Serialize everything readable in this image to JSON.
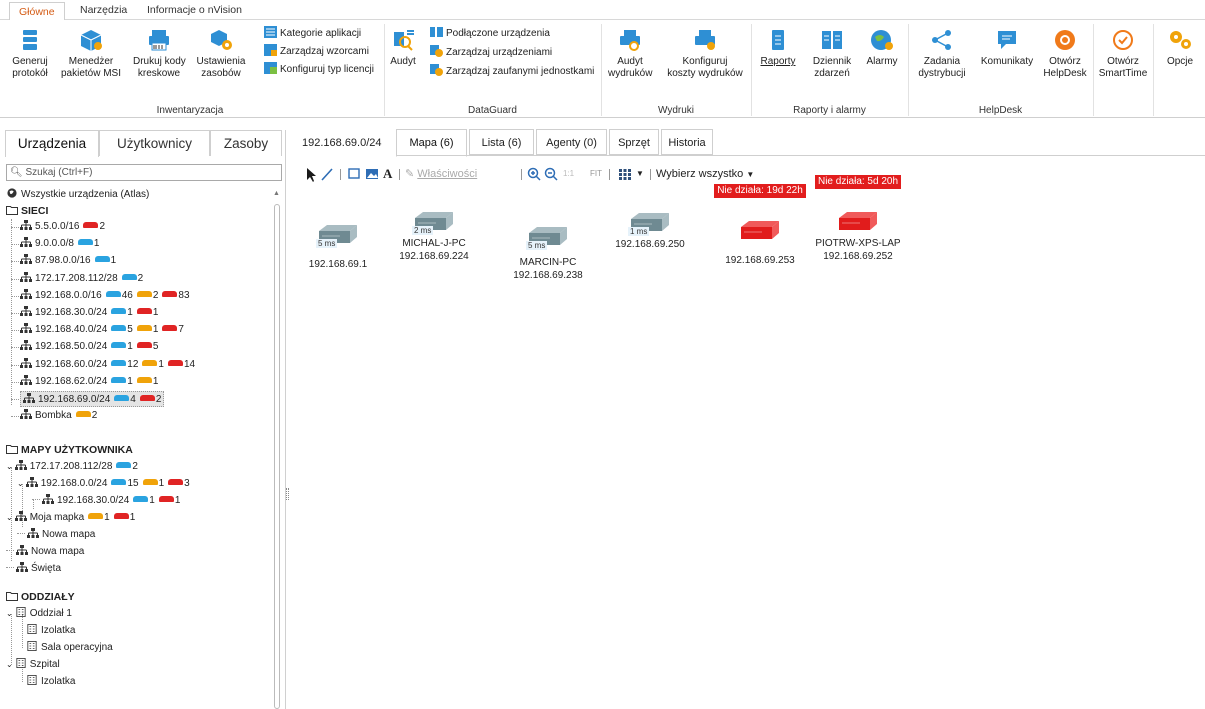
{
  "ribbon": {
    "tabs": [
      "Główne",
      "Narzędzia",
      "Informacje o nVision"
    ],
    "buttons": {
      "generuj": "Generuj\nprotokół",
      "menedzer": "Menedżer\npakietów MSI",
      "drukuj": "Drukuj kody\nkreskowe",
      "ustawienia": "Ustawienia\nzasobów",
      "kategorie": "Kategorie aplikacji",
      "wzorce": "Zarządzaj wzorcami",
      "licencje": "Konfiguruj typ licencji",
      "audyt": "Audyt",
      "podlaczone": "Podłączone urządzenia",
      "zarzadzaj_urz": "Zarządzaj urządzeniami",
      "zaufane": "Zarządzaj zaufanymi jednostkami",
      "audyt_wydrukow": "Audyt\nwydruków",
      "koszty": "Konfiguruj\nkoszty wydruków",
      "raporty": "Raporty",
      "dziennik": "Dziennik\nzdarzeń",
      "alarmy": "Alarmy",
      "zadania": "Zadania\ndystrybucji",
      "komunikaty": "Komunikaty",
      "helpdesk": "Otwórz\nHelpDesk",
      "smarttime": "Otwórz\nSmartTime",
      "opcje": "Opcje"
    },
    "groups": {
      "inwentaryzacja": "Inwentaryzacja",
      "dataguard": "DataGuard",
      "wydruki": "Wydruki",
      "raporty": "Raporty i alarmy",
      "helpdesk": "HelpDesk"
    }
  },
  "left": {
    "tabs": [
      "Urządzenia",
      "Użytkownicy",
      "Zasoby"
    ],
    "search_placeholder": "Szukaj (Ctrl+F)",
    "all_devices": "Wszystkie urządzenia (Atlas)",
    "sections": {
      "sieci": "SIECI",
      "mapy": "MAPY UŻYTKOWNIKA",
      "oddzialy": "ODDZIAŁY"
    },
    "networks": [
      {
        "name": "5.5.0.0/16",
        "counts": [
          {
            "c": "r",
            "n": "2"
          }
        ]
      },
      {
        "name": "9.0.0.0/8",
        "counts": [
          {
            "c": "b",
            "n": "1"
          }
        ]
      },
      {
        "name": "87.98.0.0/16",
        "counts": [
          {
            "c": "b",
            "n": "1"
          }
        ]
      },
      {
        "name": "172.17.208.112/28",
        "counts": [
          {
            "c": "b",
            "n": "2"
          }
        ]
      },
      {
        "name": "192.168.0.0/16",
        "counts": [
          {
            "c": "b",
            "n": "46"
          },
          {
            "c": "o",
            "n": "2"
          },
          {
            "c": "r",
            "n": "83"
          }
        ]
      },
      {
        "name": "192.168.30.0/24",
        "counts": [
          {
            "c": "b",
            "n": "1"
          },
          {
            "c": "r",
            "n": "1"
          }
        ]
      },
      {
        "name": "192.168.40.0/24",
        "counts": [
          {
            "c": "b",
            "n": "5"
          },
          {
            "c": "o",
            "n": "1"
          },
          {
            "c": "r",
            "n": "7"
          }
        ]
      },
      {
        "name": "192.168.50.0/24",
        "counts": [
          {
            "c": "b",
            "n": "1"
          },
          {
            "c": "r",
            "n": "5"
          }
        ]
      },
      {
        "name": "192.168.60.0/24",
        "counts": [
          {
            "c": "b",
            "n": "12"
          },
          {
            "c": "o",
            "n": "1"
          },
          {
            "c": "r",
            "n": "14"
          }
        ]
      },
      {
        "name": "192.168.62.0/24",
        "counts": [
          {
            "c": "b",
            "n": "1"
          },
          {
            "c": "o",
            "n": "1"
          }
        ]
      },
      {
        "name": "192.168.69.0/24",
        "counts": [
          {
            "c": "b",
            "n": "4"
          },
          {
            "c": "r",
            "n": "2"
          }
        ]
      },
      {
        "name": "Bombka",
        "counts": [
          {
            "c": "o",
            "n": "2"
          }
        ]
      }
    ],
    "maps": [
      {
        "name": "172.17.208.112/28",
        "counts": [
          {
            "c": "b",
            "n": "2"
          }
        ]
      },
      {
        "name": "192.168.0.0/24",
        "counts": [
          {
            "c": "b",
            "n": "15"
          },
          {
            "c": "o",
            "n": "1"
          },
          {
            "c": "r",
            "n": "3"
          }
        ]
      },
      {
        "name": "192.168.30.0/24",
        "counts": [
          {
            "c": "b",
            "n": "1"
          },
          {
            "c": "r",
            "n": "1"
          }
        ]
      },
      {
        "name": "Moja mapka",
        "counts": [
          {
            "c": "o",
            "n": "1"
          },
          {
            "c": "r",
            "n": "1"
          }
        ]
      },
      {
        "name": "Nowa mapa",
        "counts": []
      },
      {
        "name": "Nowa mapa",
        "counts": []
      },
      {
        "name": "Święta",
        "counts": []
      }
    ],
    "branches": [
      "Oddział 1",
      "Izolatka",
      "Sala operacyjna",
      "Szpital",
      "Izolatka"
    ]
  },
  "main": {
    "breadcrumb": "192.168.69.0/24",
    "tabs": [
      "Mapa (6)",
      "Lista (6)",
      "Agenty (0)",
      "Sprzęt",
      "Historia"
    ],
    "toolbar": {
      "properties": "Właściwości",
      "fit": "FIT",
      "select_all": "Wybierz wszystko"
    },
    "devices": [
      {
        "name": "",
        "ip": "192.168.69.1",
        "ping": "5 ms",
        "status": "up"
      },
      {
        "name": "MICHAL-J-PC",
        "ip": "192.168.69.224",
        "ping": "2 ms",
        "status": "up"
      },
      {
        "name": "MARCIN-PC",
        "ip": "192.168.69.238",
        "ping": "5 ms",
        "status": "up"
      },
      {
        "name": "",
        "ip": "192.168.69.250",
        "ping": "1 ms",
        "status": "up"
      },
      {
        "name": "",
        "ip": "192.168.69.253",
        "down": "Nie działa: 19d 22h",
        "status": "down"
      },
      {
        "name": "PIOTRW-XPS-LAP",
        "ip": "192.168.69.252",
        "down": "Nie działa: 5d 20h",
        "status": "down"
      }
    ]
  },
  "colors": {
    "accent": "#d45b14",
    "up": "#2aa3e0",
    "warn": "#f0a30a",
    "down": "#e02424"
  }
}
